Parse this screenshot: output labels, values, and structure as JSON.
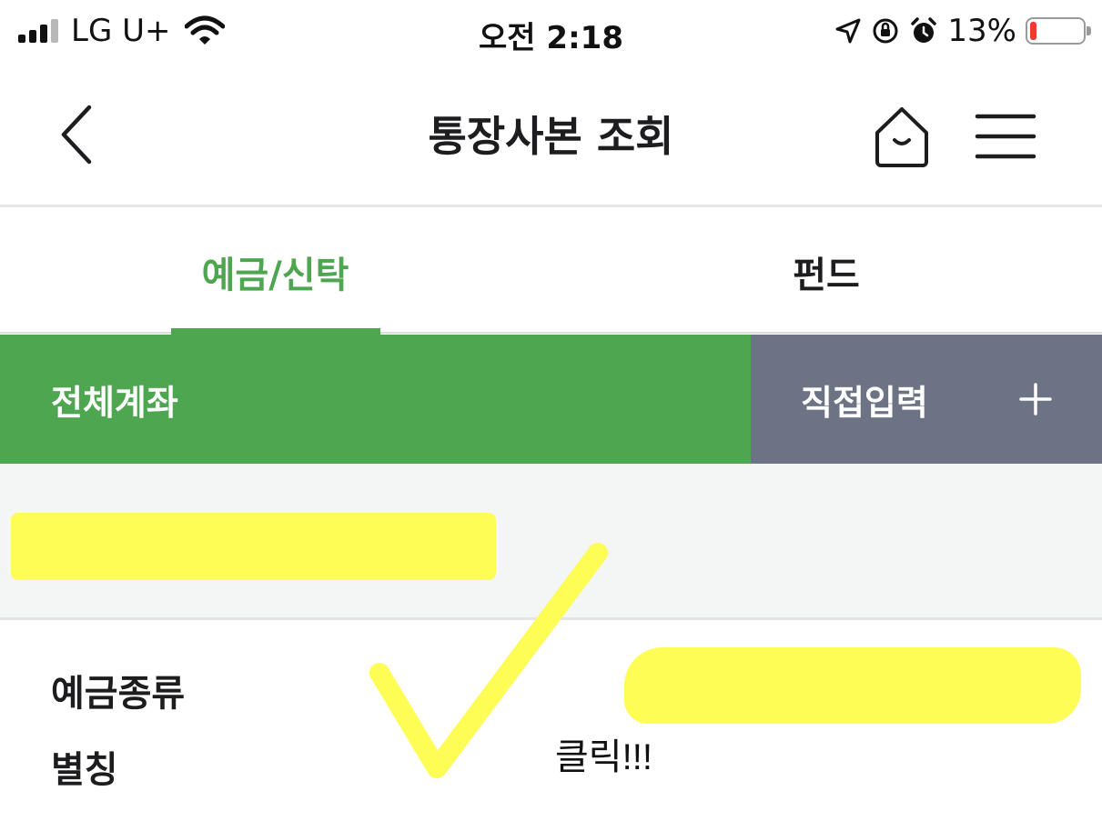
{
  "status_bar": {
    "carrier": "LG U+",
    "time": "오전 2:18",
    "battery_percent": "13%",
    "battery_level": 0.13,
    "battery_color": "#f2392f",
    "icons": [
      "signal-icon",
      "wifi-icon",
      "location-icon",
      "orientation-lock-icon",
      "alarm-icon",
      "battery-icon"
    ]
  },
  "header": {
    "title": "통장사본 조회",
    "back_icon": "chevron-left-icon",
    "home_icon": "home-icon",
    "menu_icon": "hamburger-menu-icon"
  },
  "tabs": [
    {
      "label": "예금/신탁",
      "active": true
    },
    {
      "label": "펀드",
      "active": false
    }
  ],
  "segment": {
    "all_accounts": "전체계좌",
    "direct_input": "직접입력",
    "direct_input_icon": "plus-icon"
  },
  "details": {
    "deposit_type_label": "예금종류",
    "alias_label": "별칭"
  },
  "annotation": {
    "text": "클릭!!!",
    "mark": "checkmark-icon"
  },
  "colors": {
    "accent_green": "#4ea651",
    "slate_gray": "#6b7384",
    "highlight_yellow": "#fdfd55",
    "account_bg": "#f3f6f5"
  }
}
